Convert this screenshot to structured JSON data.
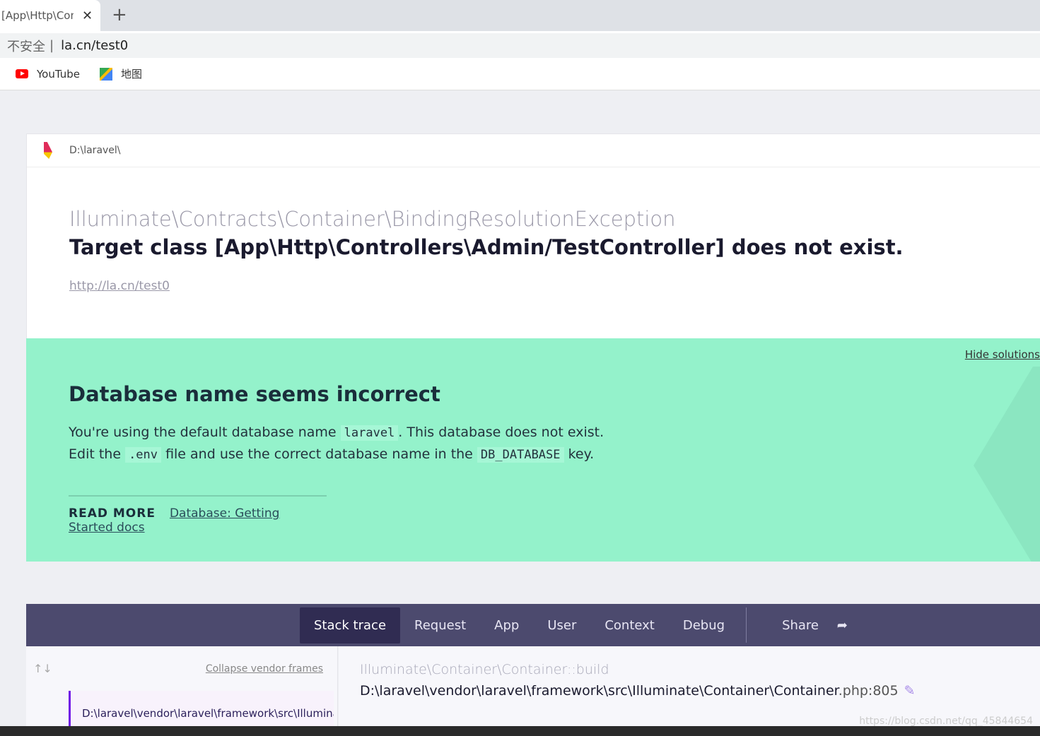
{
  "browser": {
    "tab_title": "[App\\Http\\Controllers\\Admin/TestController] does not exist",
    "insecure_label": "不安全",
    "url": "la.cn/test0",
    "bookmarks": [
      {
        "label": "YouTube",
        "icon": "youtube-icon"
      },
      {
        "label": "地图",
        "icon": "maps-icon"
      }
    ]
  },
  "header": {
    "path": "D:\\laravel\\"
  },
  "exception": {
    "class": "Illuminate\\Contracts\\Container\\BindingResolutionException",
    "message": "Target class [App\\Http\\Controllers\\Admin/TestController] does not exist.",
    "url": "http://la.cn/test0"
  },
  "solution": {
    "hide_label": "Hide solutions",
    "title": "Database name seems incorrect",
    "line1_a": "You're using the default database name",
    "code1": "laravel",
    "line1_b": ". This database does not exist.",
    "line2_a": "Edit the",
    "code2": ".env",
    "line2_b": "file and use the correct database name in the",
    "code3": "DB_DATABASE",
    "line2_c": "key.",
    "read_more": "READ MORE",
    "link": "Database: Getting Started docs",
    "bg_color": "#94f2cb"
  },
  "nav": {
    "tabs": [
      "Stack trace",
      "Request",
      "App",
      "User",
      "Context",
      "Debug"
    ],
    "share": "Share"
  },
  "stack": {
    "collapse": "Collapse vendor frames",
    "frame": "D:\\laravel\\vendor\\laravel\\framework\\src\\Illuminate\\Container\\Container.php",
    "function": "Illuminate\\Container\\Container::build",
    "file": "D:\\laravel\\vendor\\laravel\\framework\\src\\Illuminate\\Container\\Container",
    "ext": ".php:805"
  },
  "watermark": "https://blog.csdn.net/qq_45844654"
}
